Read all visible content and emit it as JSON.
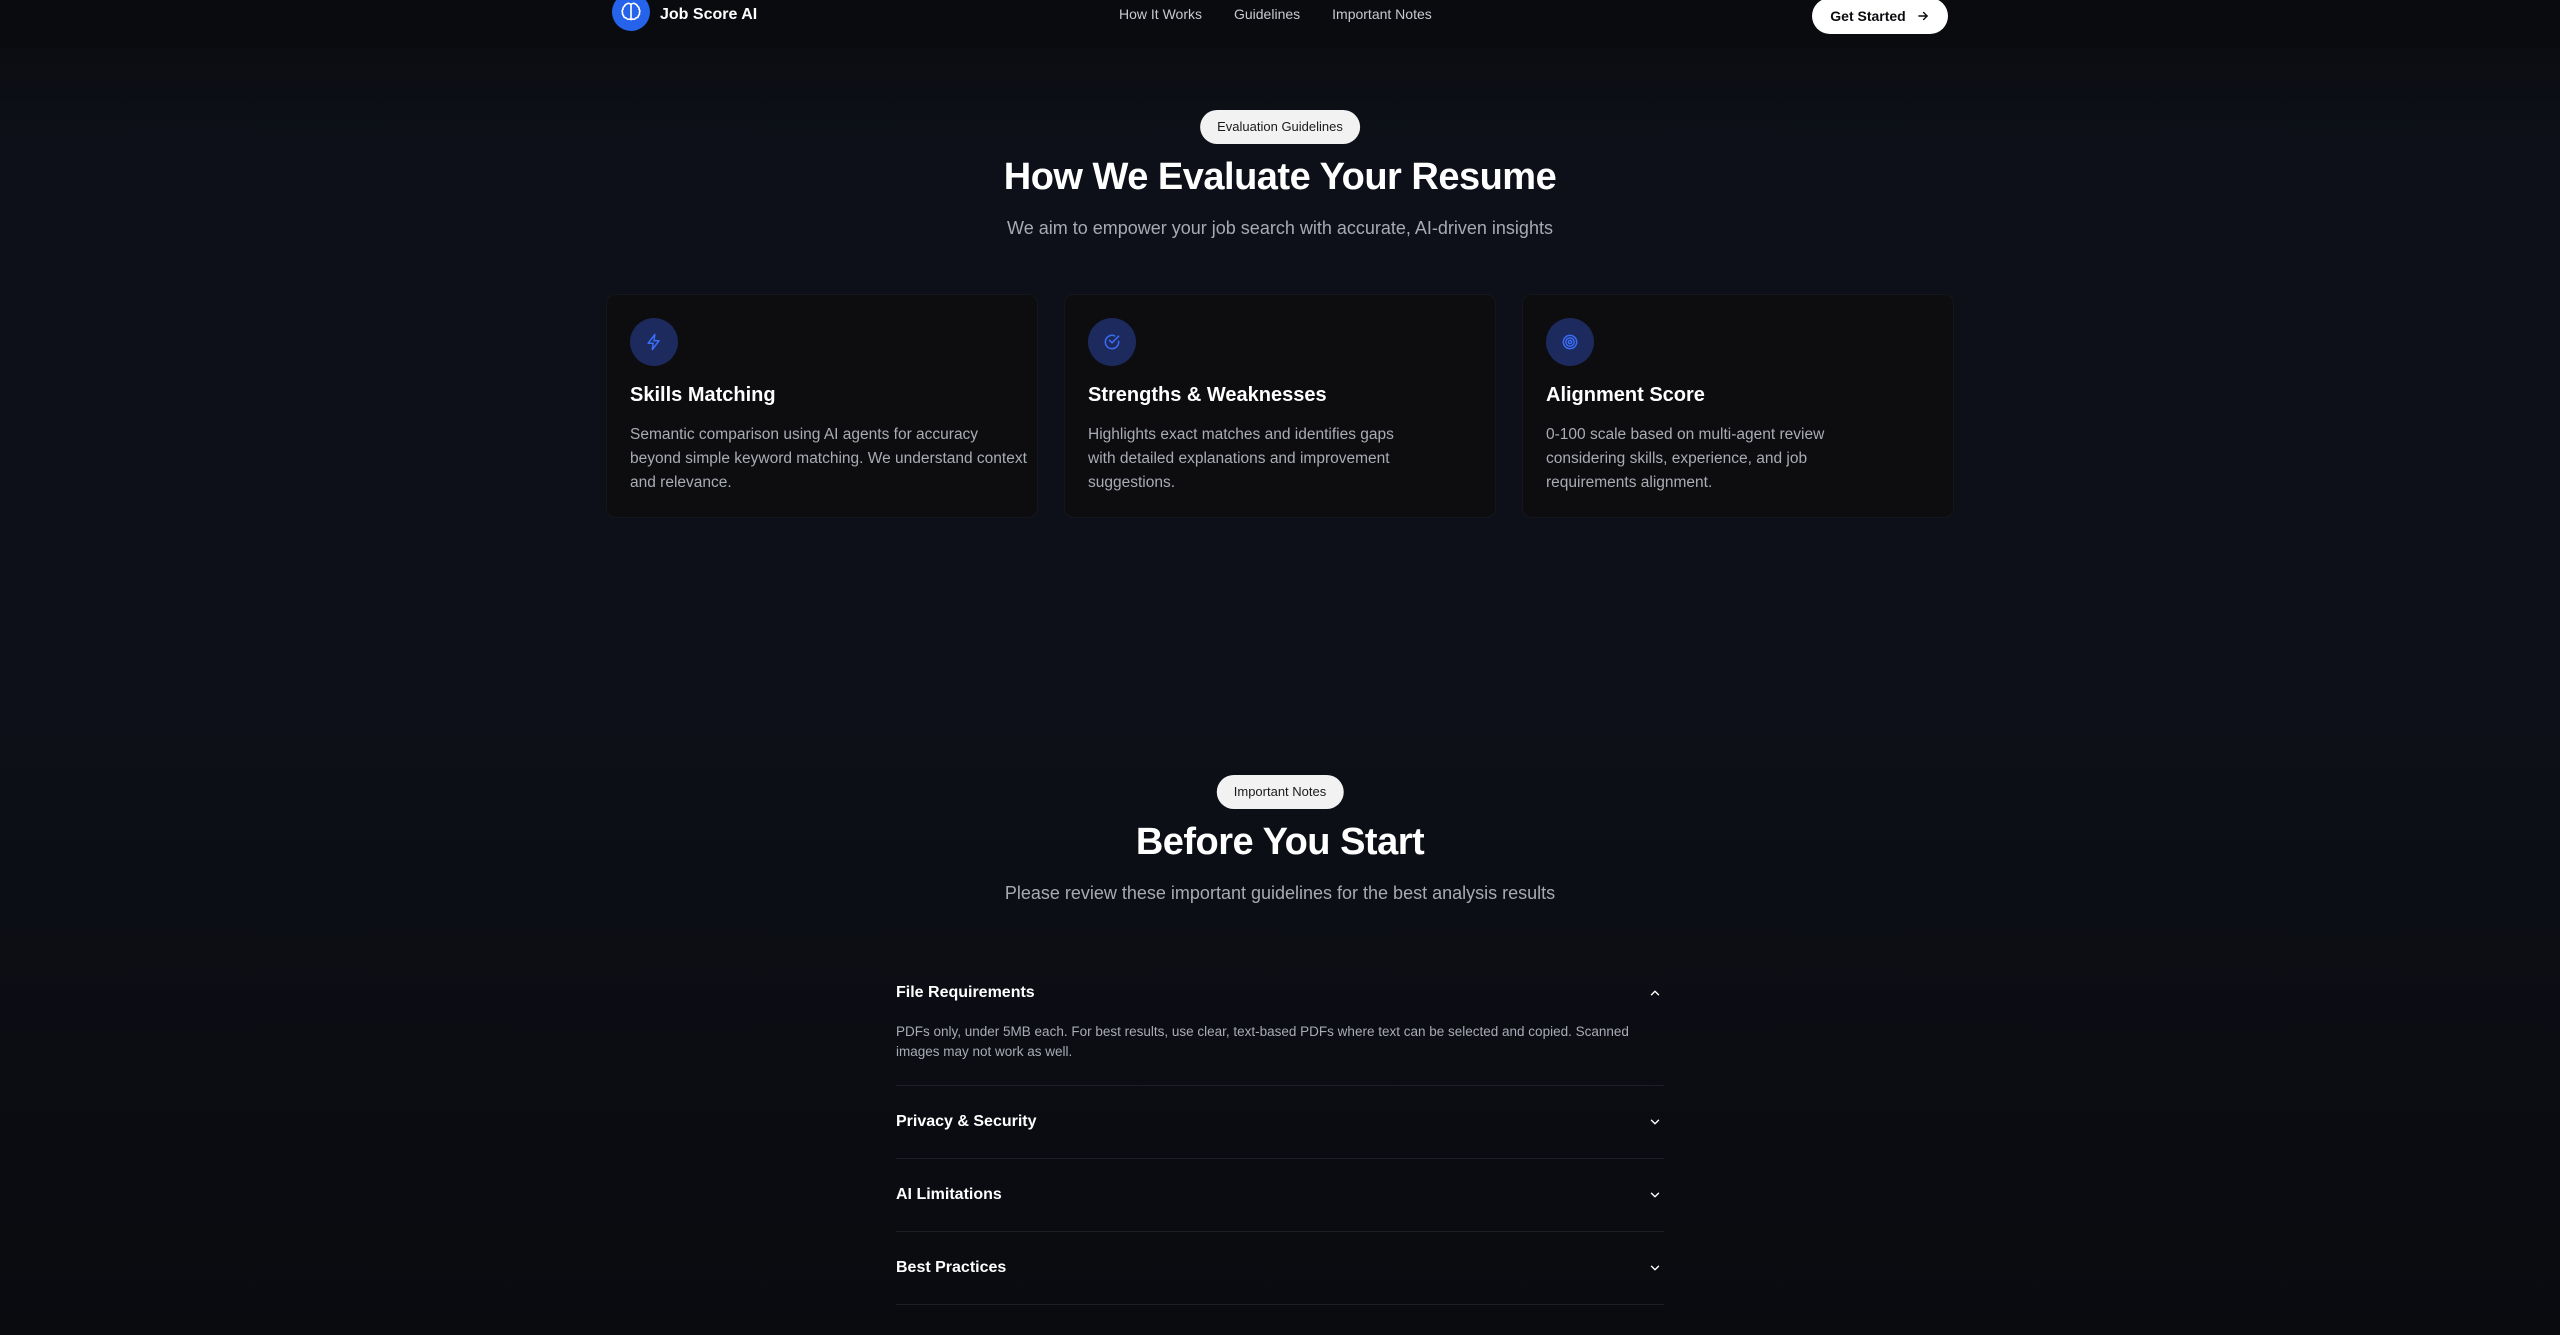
{
  "nav": {
    "brand_name": "Job Score AI",
    "links": [
      "How It Works",
      "Guidelines",
      "Important Notes"
    ],
    "cta_label": "Get Started"
  },
  "evaluation": {
    "pill": "Evaluation Guidelines",
    "title": "How We Evaluate Your Resume",
    "subtitle": "We aim to empower your job search with accurate, AI-driven insights",
    "cards": [
      {
        "icon": "lightning-icon",
        "title": "Skills Matching",
        "description": "Semantic comparison using AI agents for accuracy beyond simple keyword matching. We understand context and relevance."
      },
      {
        "icon": "check-circle-icon",
        "title": "Strengths & Weaknesses",
        "description": "Highlights exact matches and identifies gaps with detailed explanations and improvement suggestions."
      },
      {
        "icon": "target-icon",
        "title": "Alignment Score",
        "description": "0-100 scale based on multi-agent review considering skills, experience, and job requirements alignment."
      }
    ]
  },
  "notes": {
    "pill": "Important Notes",
    "title": "Before You Start",
    "subtitle": "Please review these important guidelines for the best analysis results",
    "items": [
      {
        "title": "File Requirements",
        "expanded": true,
        "body": "PDFs only, under 5MB each. For best results, use clear, text-based PDFs where text can be selected and copied. Scanned images may not work as well."
      },
      {
        "title": "Privacy & Security",
        "expanded": false
      },
      {
        "title": "AI Limitations",
        "expanded": false
      },
      {
        "title": "Best Practices",
        "expanded": false
      }
    ]
  },
  "colors": {
    "accent": "#2563eb",
    "background": "#0c0d12",
    "card": "#0d0d10",
    "muted_text": "#a9acb5"
  }
}
